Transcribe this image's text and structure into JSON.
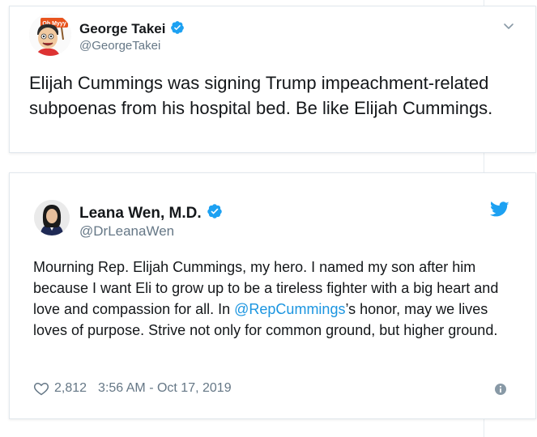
{
  "tweet1": {
    "name": "George Takei",
    "handle": "@GeorgeTakei",
    "avatar_sign_text": "Oh Myyy",
    "text": "Elijah Cummings was signing Trump impeachment-related subpoenas from his hospital bed. Be like Elijah Cummings."
  },
  "tweet2": {
    "name": "Leana Wen, M.D.",
    "handle": "@DrLeanaWen",
    "text_before_mention": "Mourning Rep. Elijah Cummings, my hero. I named my son after him because I want Eli to grow up to be a tireless fighter with a big heart and love and compassion for all. In ",
    "mention": "@RepCummings",
    "text_after_mention": "’s honor, may we lives loves of purpose. Strive not only for common ground, but higher ground.",
    "likes": "2,812",
    "timestamp": "3:56 AM - Oct 17, 2019"
  },
  "colors": {
    "verified_blue": "#1da1f2",
    "mention_blue": "#1b95e0",
    "secondary_text": "#657786",
    "border": "#e1e8ed"
  },
  "icons": [
    "verified-badge-icon",
    "chevron-down-icon",
    "twitter-bird-icon",
    "heart-icon",
    "info-icon"
  ]
}
